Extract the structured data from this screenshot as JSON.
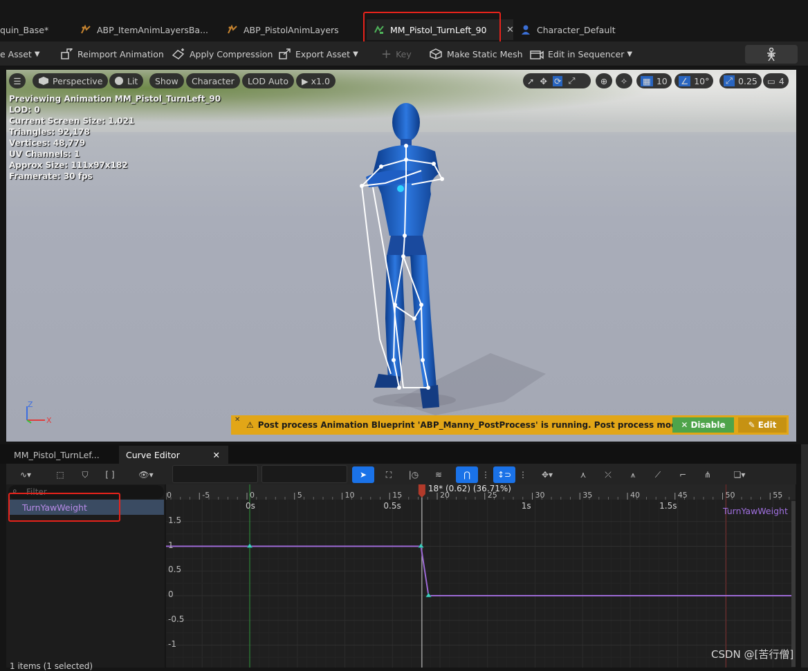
{
  "tabs": [
    {
      "label": "quin_Base*"
    },
    {
      "label": "ABP_ItemAnimLayersBa..."
    },
    {
      "label": "ABP_PistolAnimLayers"
    },
    {
      "label": "MM_Pistol_TurnLeft_90"
    },
    {
      "label": "Character_Default"
    }
  ],
  "toolbar": {
    "save_asset": "e Asset",
    "reimport": "Reimport Animation",
    "apply_compression": "Apply Compression",
    "export_asset": "Export Asset",
    "key": "Key",
    "make_static_mesh": "Make Static Mesh",
    "edit_in_sequencer": "Edit in Sequencer"
  },
  "viewport": {
    "perspective": "Perspective",
    "lit": "Lit",
    "show": "Show",
    "character": "Character",
    "lod": "LOD Auto",
    "play_rate": "x1.0",
    "grid_snap": "10",
    "rot_snap": "10°",
    "scale_snap": "0.25",
    "camera_speed": "4",
    "stats": [
      "Previewing Animation MM_Pistol_TurnLeft_90",
      "LOD: 0",
      "Current Screen Size: 1.021",
      "Triangles: 92,178",
      "Vertices: 48,779",
      "UV Channels: 1",
      "Approx Size: 111x97x182",
      "Framerate: 30 fps"
    ],
    "axis_z": "Z",
    "axis_x": "X",
    "warning": {
      "text": "Post process Animation Blueprint 'ABP_Manny_PostProcess' is running. Post process modifes curves.",
      "disable": "Disable",
      "edit": "Edit"
    }
  },
  "bottom_tabs": [
    {
      "label": "MM_Pistol_TurnLef..."
    },
    {
      "label": "Curve Editor"
    }
  ],
  "curve_tree": {
    "filter_placeholder": "Filter",
    "item": "TurnYawWeight",
    "footer": "1 items (1 selected)"
  },
  "timeline": {
    "frame_ticks": [
      "0",
      "-5",
      "0",
      "5",
      "10",
      "15",
      "20",
      "25",
      "30",
      "35",
      "40",
      "45",
      "50",
      "55"
    ],
    "time_labels": [
      "0s",
      "0.5s",
      "1s",
      "1.5s"
    ],
    "playhead_label": "18* (0.62) (36.71%)",
    "y_labels": [
      "1.5",
      "1",
      "0.5",
      "0",
      "-0.5",
      "-1"
    ],
    "curve_label": "TurnYawWeight"
  },
  "chart_data": {
    "type": "line",
    "series": [
      {
        "name": "TurnYawWeight",
        "x": [
          0,
          18,
          18.8,
          58
        ],
        "y": [
          1,
          1,
          0,
          0
        ]
      }
    ],
    "xlabel": "",
    "ylabel": "",
    "ylim": [
      -1.5,
      1.5
    ]
  },
  "watermark": "CSDN @[苦行僧]"
}
